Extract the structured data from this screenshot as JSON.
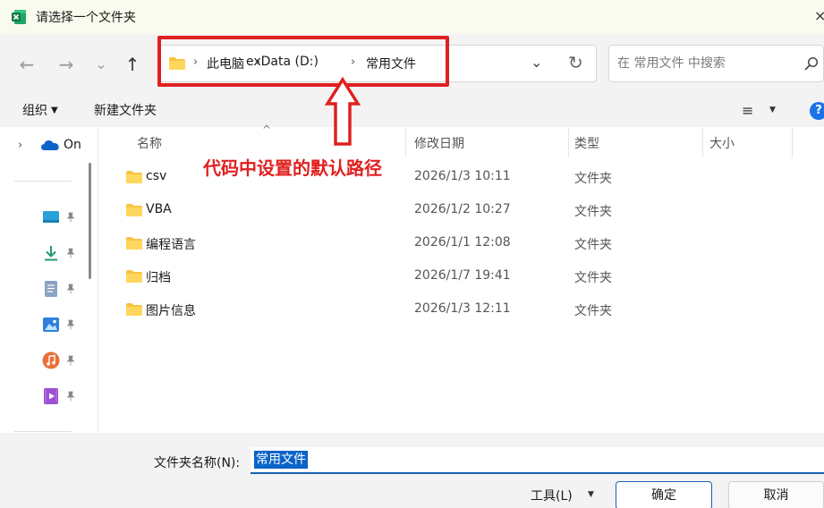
{
  "window": {
    "title": "请选择一个文件夹",
    "close_glyph": "×",
    "app_icon": "excel-icon"
  },
  "nav": {
    "back": "←",
    "forward": "→",
    "recent": "⌄",
    "up": "↑"
  },
  "address": {
    "crumbs": [
      "此电脑",
      "exData (D:)",
      "常用文件"
    ],
    "separator": "›",
    "dropdown_glyph": "⌄",
    "refresh_glyph": "↻"
  },
  "search": {
    "placeholder": "在 常用文件 中搜索"
  },
  "annotation": {
    "text": "代码中设置的默认路径",
    "color": "#e02020"
  },
  "toolbar": {
    "organize": "组织",
    "new_folder": "新建文件夹",
    "view_glyph": "≡",
    "help_glyph": "?"
  },
  "left_pane": {
    "onedrive_label": "On"
  },
  "columns": {
    "name": "名称",
    "date": "修改日期",
    "type": "类型",
    "size": "大小",
    "sort_glyph": "^"
  },
  "files": [
    {
      "name": "csv",
      "date": "2026/1/3 10:11",
      "type": "文件夹"
    },
    {
      "name": "VBA",
      "date": "2026/1/2 10:27",
      "type": "文件夹"
    },
    {
      "name": "编程语言",
      "date": "2026/1/1 12:08",
      "type": "文件夹"
    },
    {
      "name": "归档",
      "date": "2026/1/7 19:41",
      "type": "文件夹"
    },
    {
      "name": "图片信息",
      "date": "2026/1/3 12:11",
      "type": "文件夹"
    }
  ],
  "bottom": {
    "folder_name_label": "文件夹名称(N):",
    "folder_name_value": "常用文件",
    "tools": "工具(L)",
    "ok": "确定",
    "cancel": "取消"
  },
  "colors": {
    "accent": "#1a5fb4",
    "selection": "#0a64c8",
    "folder": "#f6c343",
    "annotation_red": "#e02020"
  }
}
